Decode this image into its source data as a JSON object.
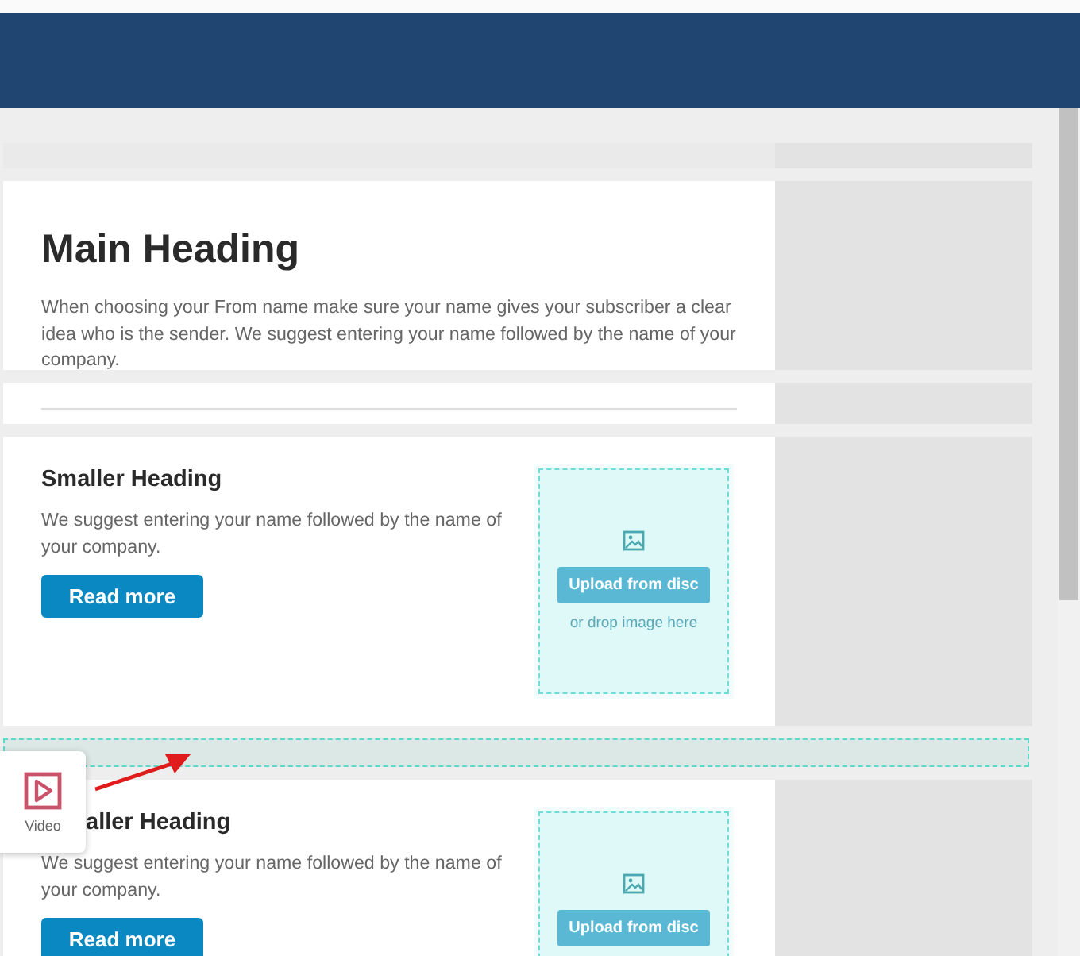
{
  "sections": [
    {
      "kind": "spacer"
    },
    {
      "kind": "text",
      "heading": "Main Heading",
      "body": "When choosing your From name make sure your name gives your subscriber a clear idea who is the sender. We suggest entering your name followed by the name of your company."
    },
    {
      "kind": "divider"
    },
    {
      "kind": "article",
      "covered": false,
      "heading": "Smaller Heading",
      "body": "We suggest entering your name followed by the name of your company.",
      "button": "Read more",
      "upload": {
        "button": "Upload from disc",
        "hint": "or drop image here"
      }
    },
    {
      "kind": "dropzone"
    },
    {
      "kind": "article",
      "covered": true,
      "heading": "aller Heading",
      "body": "We suggest entering your name followed by the name of your company.",
      "button": "Read more",
      "upload": {
        "button": "Upload from disc"
      }
    }
  ],
  "widget": {
    "label": "Video"
  }
}
